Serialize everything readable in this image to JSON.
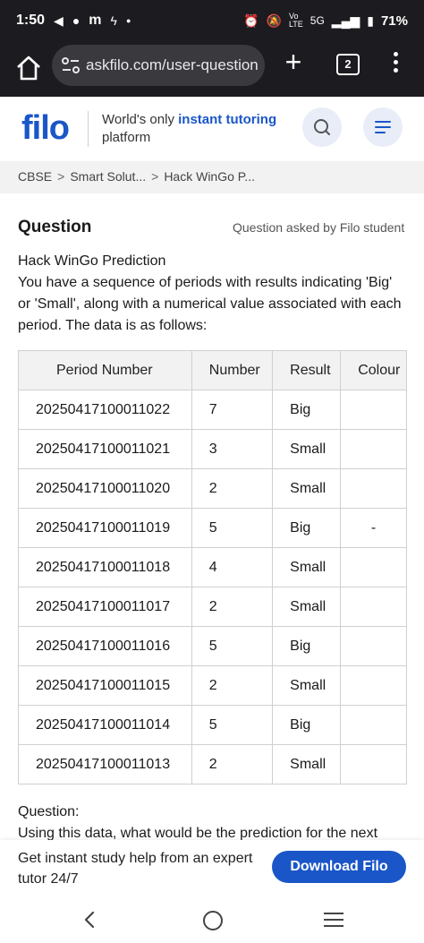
{
  "status_bar": {
    "time": "1:50",
    "icons_left": [
      "telegram-icon",
      "location-icon",
      "gmail-icon",
      "bolt-icon",
      "dot-icon"
    ],
    "icons_right": [
      "alarm-icon",
      "mute-icon",
      "volte-icon",
      "signal-icon",
      "battery-icon"
    ],
    "network": "5G",
    "battery": "71%"
  },
  "browser": {
    "url": "askfilo.com/user-question",
    "tab_count": "2"
  },
  "header": {
    "logo": "filo",
    "tagline_pre": "World's only ",
    "tagline_highlight": "instant tutoring",
    "tagline_post": "platform",
    "accent_color": "#1a56c8"
  },
  "breadcrumb": {
    "items": [
      "CBSE",
      "Smart Solut...",
      "Hack WinGo P..."
    ],
    "separator": ">"
  },
  "question": {
    "heading": "Question",
    "meta": "Question asked by Filo student",
    "title_line": "Hack WinGo Prediction",
    "body": "You have a sequence of periods with results indicating 'Big' or 'Small', along with a numerical value associated with each period. The data is as follows:",
    "table": {
      "headers": [
        "Period Number",
        "Number",
        "Result",
        "Colour"
      ],
      "rows": [
        [
          "20250417100011022",
          "7",
          "Big",
          ""
        ],
        [
          "20250417100011021",
          "3",
          "Small",
          ""
        ],
        [
          "20250417100011020",
          "2",
          "Small",
          ""
        ],
        [
          "20250417100011019",
          "5",
          "Big",
          "-"
        ],
        [
          "20250417100011018",
          "4",
          "Small",
          ""
        ],
        [
          "20250417100011017",
          "2",
          "Small",
          ""
        ],
        [
          "20250417100011016",
          "5",
          "Big",
          ""
        ],
        [
          "20250417100011015",
          "2",
          "Small",
          ""
        ],
        [
          "20250417100011014",
          "5",
          "Big",
          ""
        ],
        [
          "20250417100011013",
          "2",
          "Small",
          ""
        ]
      ]
    },
    "after_label": "Question:",
    "after_text": "Using this data, what would be the prediction for the next"
  },
  "cta": {
    "text": "Get instant study help from an expert tutor 24/7",
    "button": "Download Filo"
  }
}
